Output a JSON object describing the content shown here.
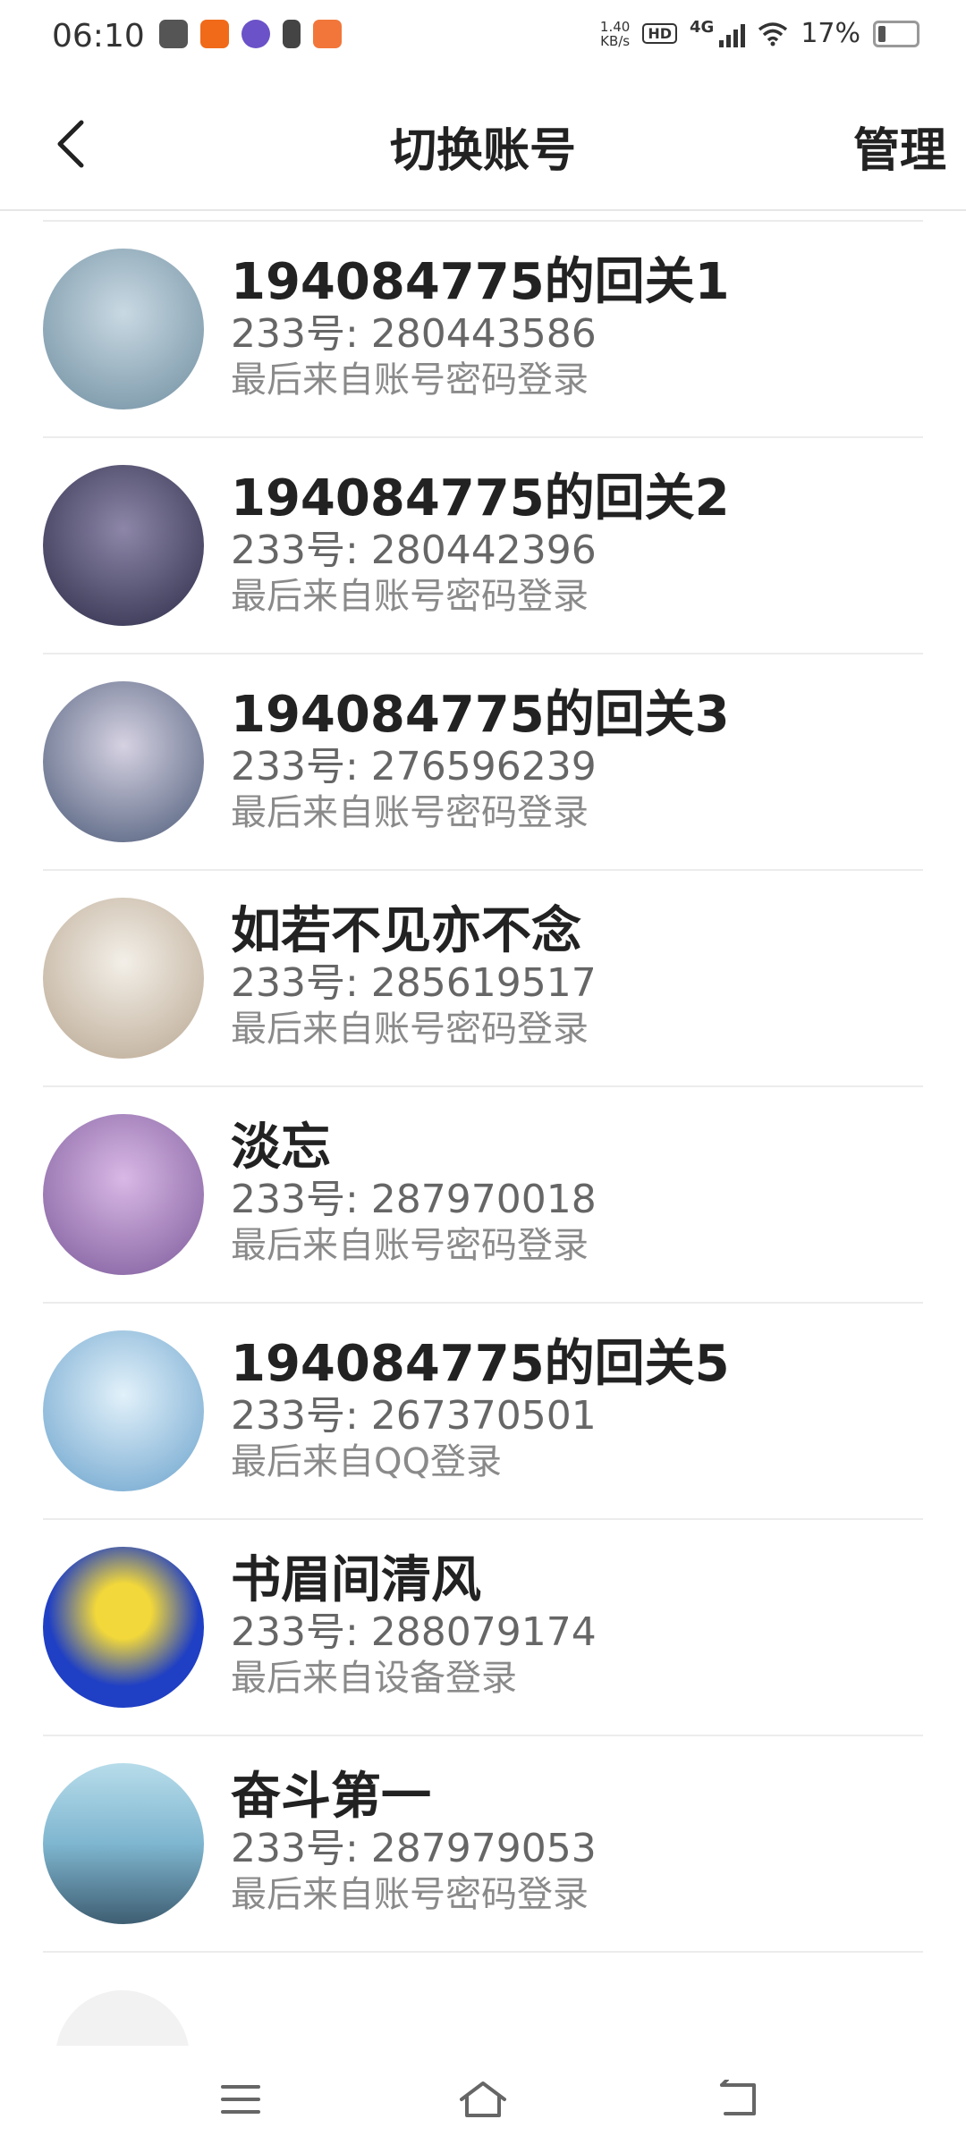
{
  "status_bar": {
    "time": "06:10",
    "net_speed_value": "1.40",
    "net_speed_unit": "KB/s",
    "hd_label": "HD",
    "network": "4G",
    "battery": "17%"
  },
  "header": {
    "title": "切换账号",
    "manage_label": "管理"
  },
  "accounts": [
    {
      "name": "194084775的回关1",
      "uid": "233号: 280443586",
      "source": "最后来自账号密码登录",
      "avatar_colors": [
        "#6f8ea0",
        "#c9d9e3"
      ]
    },
    {
      "name": "194084775的回关2",
      "uid": "233号: 280442396",
      "source": "最后来自账号密码登录",
      "avatar_colors": [
        "#2c2c48",
        "#8d86a8"
      ]
    },
    {
      "name": "194084775的回关3",
      "uid": "233号: 276596239",
      "source": "最后来自账号密码登录",
      "avatar_colors": [
        "#b8b4c8",
        "#4b5a78"
      ]
    },
    {
      "name": "如若不见亦不念",
      "uid": "233号: 285619517",
      "source": "最后来自账号密码登录",
      "avatar_colors": [
        "#ece6dc",
        "#b9a791"
      ]
    },
    {
      "name": "淡忘",
      "uid": "233号: 287970018",
      "source": "最后来自账号密码登录",
      "avatar_colors": [
        "#b591c9",
        "#7c5a9a"
      ]
    },
    {
      "name": "194084775的回关5",
      "uid": "233号: 267370501",
      "source": "最后来自QQ登录",
      "avatar_colors": [
        "#bcdcf0",
        "#6aa2cc"
      ]
    },
    {
      "name": "书眉间清风",
      "uid": "233号: 288079174",
      "source": "最后来自设备登录",
      "avatar_colors": [
        "#1f3fc4",
        "#f2d83a"
      ]
    },
    {
      "name": "奋斗第一",
      "uid": "233号: 287979053",
      "source": "最后来自账号密码登录",
      "avatar_colors": [
        "#7fb6d0",
        "#3e5e72"
      ]
    }
  ],
  "colors": {
    "divider": "#ececec",
    "name_text": "#222222",
    "uid_text": "#666666",
    "source_text": "#8a8a8a"
  }
}
